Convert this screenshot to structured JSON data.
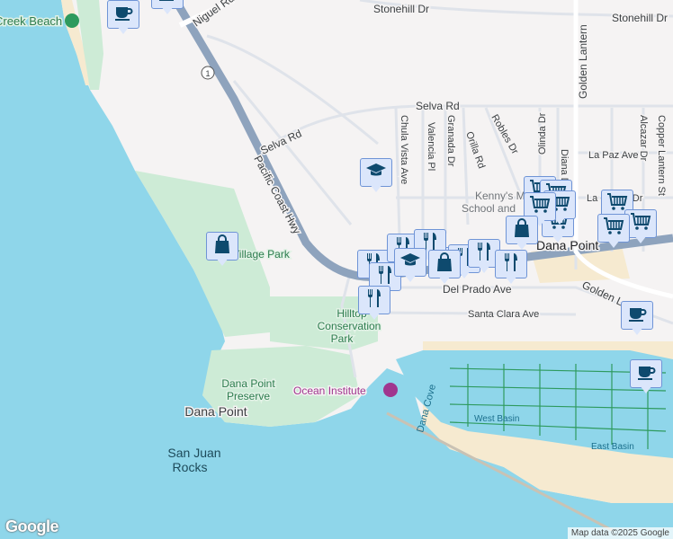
{
  "map": {
    "labels": {
      "creek_beach": "Creek Beach",
      "stonehill_1": "Stonehill Dr",
      "stonehill_2": "Stonehill Dr",
      "niguel": "Niguel Rd",
      "golden_lantern": "Golden Lantern",
      "golden_lantern_2": "Golden Lantern",
      "selva_1": "Selva Rd",
      "selva_2": "Selva Rd",
      "pch": "Pacific Coast Hwy",
      "route_shield": "1",
      "chula_vista": "Chula Vista Ave",
      "valencia": "Valencia Pl",
      "granada": "Granada Dr",
      "orilla": "Orilla Rd",
      "robles": "Robles Dr",
      "olinda": "Olinda Dr",
      "diana": "Diana Dr",
      "la_paz": "La Paz Ave",
      "alcazar": "Alcazar Dr",
      "copper_lantern": "Copper Lantern St",
      "kennys_1": "Kenny's Music",
      "kennys_2": "School and",
      "la_cresta": "La Cresta Dr",
      "dana_point_town": "Dana Point",
      "del_prado": "Del Prado Ave",
      "santa_clara": "Santa Clara Ave",
      "hilltop_1": "Hilltop",
      "hilltop_2": "Conservation",
      "hilltop_3": "Park",
      "preserve_1": "Dana Point",
      "preserve_2": "Preserve",
      "dana_point_headland": "Dana Point",
      "ocean_institute": "Ocean Institute",
      "san_juan_1": "San Juan",
      "san_juan_2": "Rocks",
      "dana_cove": "Dana Cove",
      "west_basin": "West Basin",
      "east_basin": "East Basin",
      "village_park": "Village Park"
    },
    "markers": [
      "coffee",
      "coffee",
      "education",
      "shopping",
      "cart",
      "cart",
      "cart",
      "cart",
      "cart",
      "cart",
      "cart",
      "cart",
      "shopping",
      "shopping",
      "restaurant",
      "restaurant",
      "restaurant",
      "restaurant",
      "restaurant",
      "restaurant",
      "restaurant",
      "education",
      "shopping",
      "restaurant",
      "coffee",
      "coffee"
    ],
    "colors": {
      "water": "#8fd6ea",
      "land": "#f5f3f3",
      "park": "#cdebd6",
      "sand": "#f6ead0",
      "highway": "#8ea3bd",
      "marker_fill": "#dbe6fb",
      "marker_icon": "#0e4a6e"
    },
    "footer": "Map data ©2025 Google",
    "logo": "Google"
  }
}
